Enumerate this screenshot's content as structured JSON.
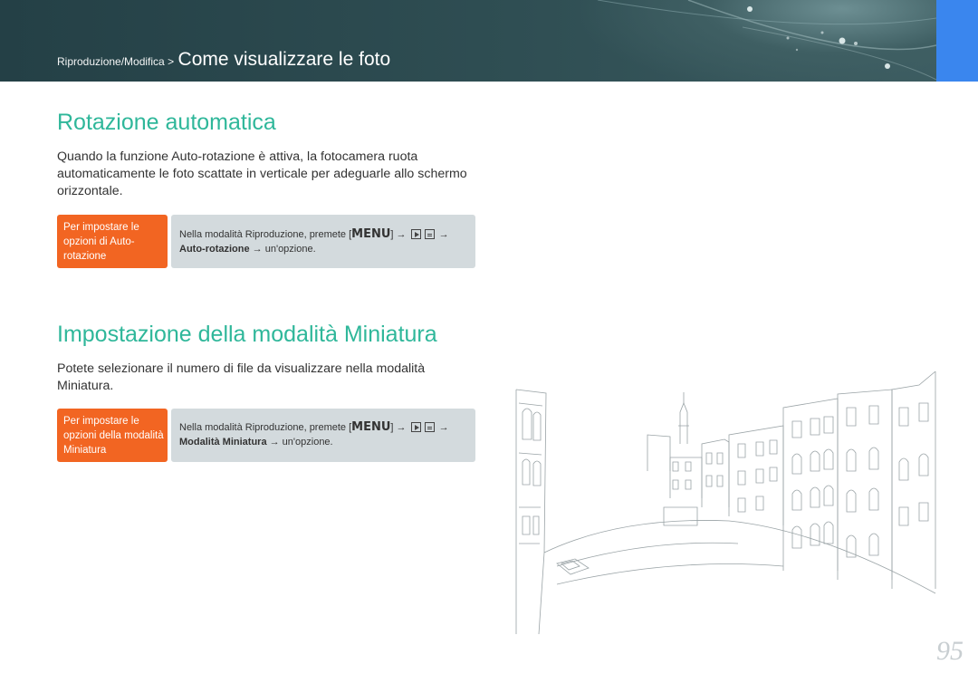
{
  "header": {
    "breadcrumb_section": "Riproduzione/Modifica >",
    "breadcrumb_title": "Come visualizzare le foto"
  },
  "section1": {
    "title": "Rotazione automatica",
    "body": "Quando la funzione Auto-rotazione è attiva, la fotocamera ruota automaticamente le foto scattate in verticale per adeguarle allo schermo orizzontale.",
    "tag": "Per impostare le opzioni di Auto-rotazione",
    "step_prefix": "Nella modalità Riproduzione, premete [",
    "menu_key": "MENU",
    "step_mid": "] →",
    "arrow": "→",
    "option": "Auto-rotazione",
    "step_suffix": "→ un'opzione."
  },
  "section2": {
    "title": "Impostazione della modalità Miniatura",
    "body": "Potete selezionare il numero di file da visualizzare nella modalità Miniatura.",
    "tag": "Per impostare le opzioni della modalità Miniatura",
    "step_prefix": "Nella modalità Riproduzione, premete [",
    "menu_key": "MENU",
    "step_mid": "] →",
    "arrow": "→",
    "option": "Modalità Miniatura",
    "step_suffix": "→ un'opzione."
  },
  "page_number": "95",
  "colors": {
    "header_bg": "#2f4e53",
    "blue_tab": "#3a86ee",
    "heading": "#2fb79a",
    "tag_bg": "#f26522",
    "step_bg": "#d3dadd"
  }
}
